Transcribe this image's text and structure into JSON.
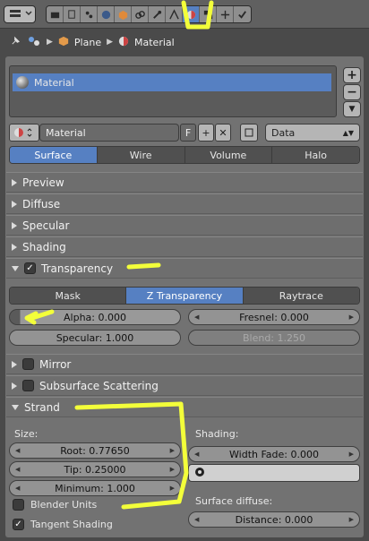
{
  "breadcrumb": {
    "object": "Plane",
    "material": "Material"
  },
  "slot_list": {
    "items": [
      "Material"
    ]
  },
  "datablock": {
    "name": "Material",
    "fake_user": "F",
    "link": "Data"
  },
  "material_tabs": [
    "Surface",
    "Wire",
    "Volume",
    "Halo"
  ],
  "sections": {
    "preview": "Preview",
    "diffuse": "Diffuse",
    "specular": "Specular",
    "shading": "Shading",
    "transparency": "Transparency",
    "mirror": "Mirror",
    "sss": "Subsurface Scattering",
    "strand": "Strand"
  },
  "transparency": {
    "modes": [
      "Mask",
      "Z Transparency",
      "Raytrace"
    ],
    "alpha": "Alpha: 0.000",
    "fresnel": "Fresnel: 0.000",
    "specular": "Specular: 1.000",
    "blend": "Blend: 1.250"
  },
  "strand": {
    "size_label": "Size:",
    "root": "Root: 0.77650",
    "tip": "Tip: 0.25000",
    "minimum": "Minimum: 1.000",
    "blender_units": "Blender Units",
    "tangent_shading": "Tangent Shading",
    "shading_label": "Shading:",
    "width_fade": "Width Fade: 0.000",
    "surface_diffuse": "Surface diffuse:",
    "distance": "Distance: 0.000"
  },
  "colors": {
    "accent": "#5680c2",
    "annotation": "#f3ff3a",
    "panel": "#727272"
  }
}
